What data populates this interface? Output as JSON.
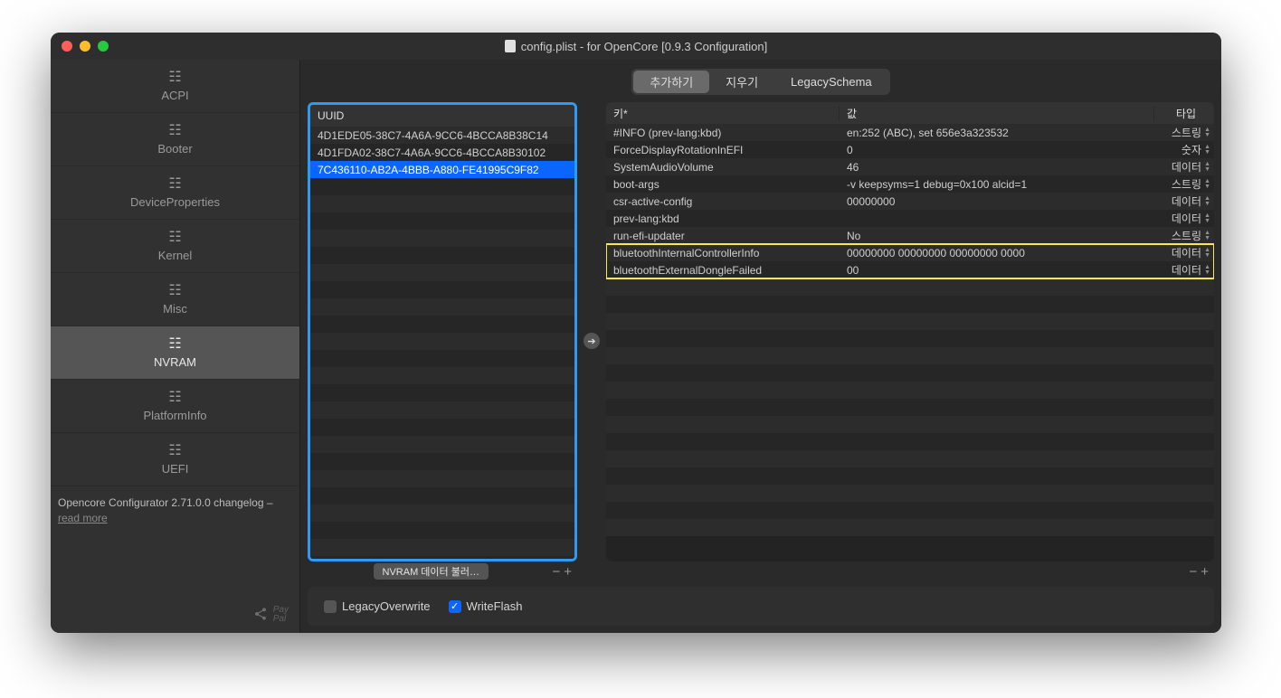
{
  "window": {
    "title": "config.plist - for OpenCore [0.9.3 Configuration]"
  },
  "sidebar": {
    "items": [
      {
        "label": "ACPI"
      },
      {
        "label": "Booter"
      },
      {
        "label": "DeviceProperties"
      },
      {
        "label": "Kernel"
      },
      {
        "label": "Misc"
      },
      {
        "label": "NVRAM"
      },
      {
        "label": "PlatformInfo"
      },
      {
        "label": "UEFI"
      }
    ],
    "active_index": 5,
    "changelog_text": "Opencore Configurator 2.71.0.0 changelog –",
    "changelog_link": "read more",
    "paypal": "Pay\nPal"
  },
  "segmented": {
    "items": [
      "추가하기",
      "지우기",
      "LegacySchema"
    ],
    "active_index": 0
  },
  "uuid_table": {
    "header": "UUID",
    "rows": [
      "4D1EDE05-38C7-4A6A-9CC6-4BCCA8B38C14",
      "4D1FDA02-38C7-4A6A-9CC6-4BCCA8B30102",
      "7C436110-AB2A-4BBB-A880-FE41995C9F82"
    ],
    "selected_index": 2,
    "footer_button": "NVRAM 데이터 불러…"
  },
  "kv_table": {
    "headers": {
      "key": "키*",
      "value": "값",
      "type": "타입"
    },
    "rows": [
      {
        "key": "#INFO (prev-lang:kbd)",
        "value": "en:252 (ABC), set 656e3a323532",
        "type": "스트링",
        "hl": false
      },
      {
        "key": "ForceDisplayRotationInEFI",
        "value": "0",
        "type": "숫자",
        "hl": false
      },
      {
        "key": "SystemAudioVolume",
        "value": "46",
        "type": "데이터",
        "hl": false
      },
      {
        "key": "boot-args",
        "value": "-v keepsyms=1 debug=0x100 alcid=1",
        "type": "스트링",
        "hl": false
      },
      {
        "key": "csr-active-config",
        "value": "00000000",
        "type": "데이터",
        "hl": false
      },
      {
        "key": "prev-lang:kbd",
        "value": "",
        "type": "데이터",
        "hl": false
      },
      {
        "key": "run-efi-updater",
        "value": "No",
        "type": "스트링",
        "hl": false
      },
      {
        "key": "bluetoothInternalControllerInfo",
        "value": "00000000 00000000 00000000 0000",
        "type": "데이터",
        "hl": true
      },
      {
        "key": "bluetoothExternalDongleFailed",
        "value": "00",
        "type": "데이터",
        "hl": true
      }
    ]
  },
  "bottom_bar": {
    "legacy_overwrite_label": "LegacyOverwrite",
    "legacy_overwrite_checked": false,
    "write_flash_label": "WriteFlash",
    "write_flash_checked": true
  }
}
